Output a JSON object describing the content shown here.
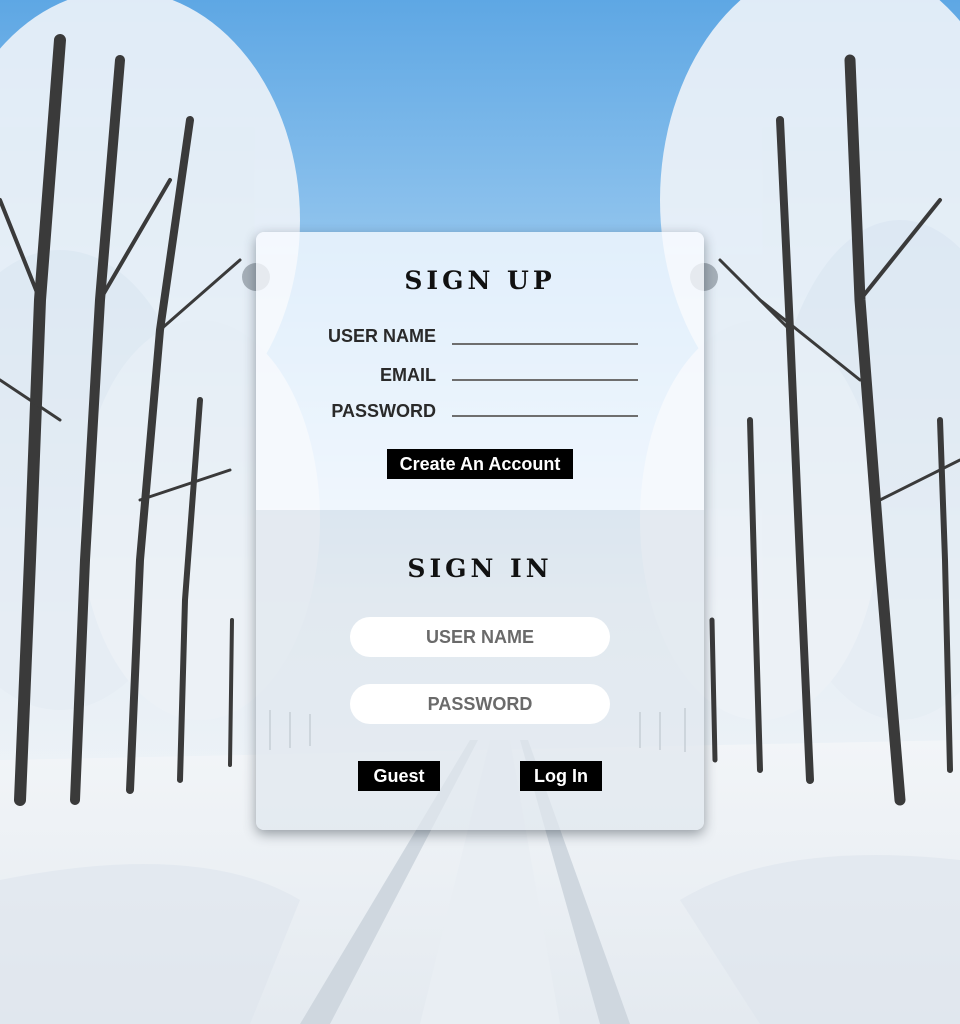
{
  "signup": {
    "title": "SIGN UP",
    "fields": [
      {
        "label": "USER NAME"
      },
      {
        "label": "EMAIL"
      },
      {
        "label": "PASSWORD"
      }
    ],
    "create_button": "Create An Account"
  },
  "signin": {
    "title": "SIGN IN",
    "username_placeholder": "USER NAME",
    "password_placeholder": "PASSWORD",
    "guest_button": "Guest",
    "login_button": "Log In"
  },
  "colors": {
    "button_bg": "#000000",
    "button_text": "#ffffff",
    "sky": "#7ab8e8",
    "snow": "#f3f5f8"
  },
  "background": "snowy-tree-lined-road"
}
